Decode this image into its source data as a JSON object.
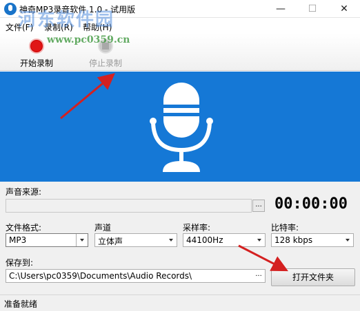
{
  "window": {
    "title": "神奇MP3录音软件 1.0 - 试用版",
    "min": "—",
    "max": "☐",
    "close": "✕"
  },
  "menu": {
    "items": [
      "文件(F)",
      "录制(R)",
      "帮助(H)"
    ]
  },
  "toolbar": {
    "start_label": "开始录制",
    "stop_label": "停止录制"
  },
  "watermark": {
    "text": "河东软件园",
    "url": "www.pc0359.cn"
  },
  "panel": {
    "source_label": "声音来源:",
    "source_value": "",
    "browse_label": "...",
    "timer": "00:00:00",
    "format_label": "文件格式:",
    "format_value": "MP3",
    "channel_label": "声道",
    "channel_value": "立体声",
    "samplerate_label": "采样率:",
    "samplerate_value": "44100Hz",
    "bitrate_label": "比特率:",
    "bitrate_value": "128 kbps",
    "saveto_label": "保存到:",
    "saveto_value": "C:\\Users\\pc0359\\Documents\\Audio Records\\",
    "saveto_browse": "...",
    "open_folder": "打开文件夹"
  },
  "status": {
    "text": "准备就绪"
  },
  "colors": {
    "banner": "#1578d6",
    "record": "#e01616",
    "arrow": "#d42020"
  },
  "icons": {
    "app": "app-icon",
    "record": "record-icon",
    "stop": "stop-icon",
    "microphone": "microphone-icon"
  }
}
